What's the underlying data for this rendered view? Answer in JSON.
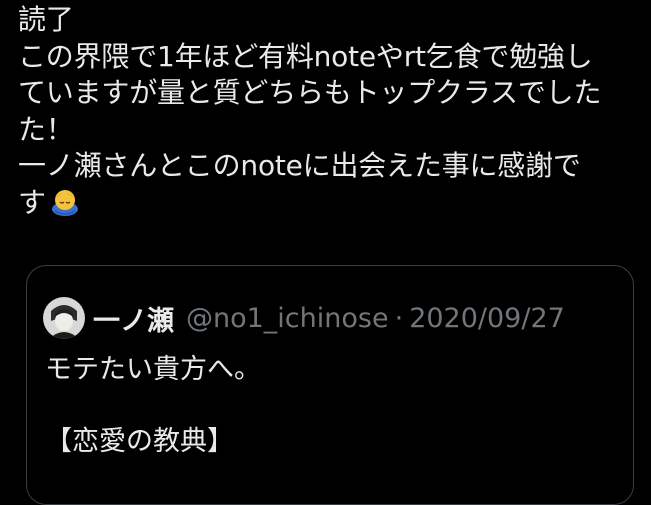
{
  "tweet": {
    "lines": [
      "読了",
      "この界隈で1年ほど有料noteやrt乞食で勉強し",
      "ていますが量と質どちらもトップクラスでした",
      "た！",
      "一ノ瀬さんとこのnoteに出会えた事に感謝で",
      "す"
    ],
    "trailing_emoji": "bowing-person-emoji"
  },
  "quoted_tweet": {
    "author_name": "一ノ瀬",
    "handle": "@no1_ichinose",
    "separator": "·",
    "date": "2020/09/27",
    "body_lines": [
      "モテたい貴方へ。",
      "",
      "【恋愛の教典】"
    ]
  },
  "colors": {
    "background": "#000000",
    "text": "#e7e9ea",
    "muted": "#71767b",
    "card_border": "#3a3d41",
    "emoji_skin": "#f5c33b"
  }
}
